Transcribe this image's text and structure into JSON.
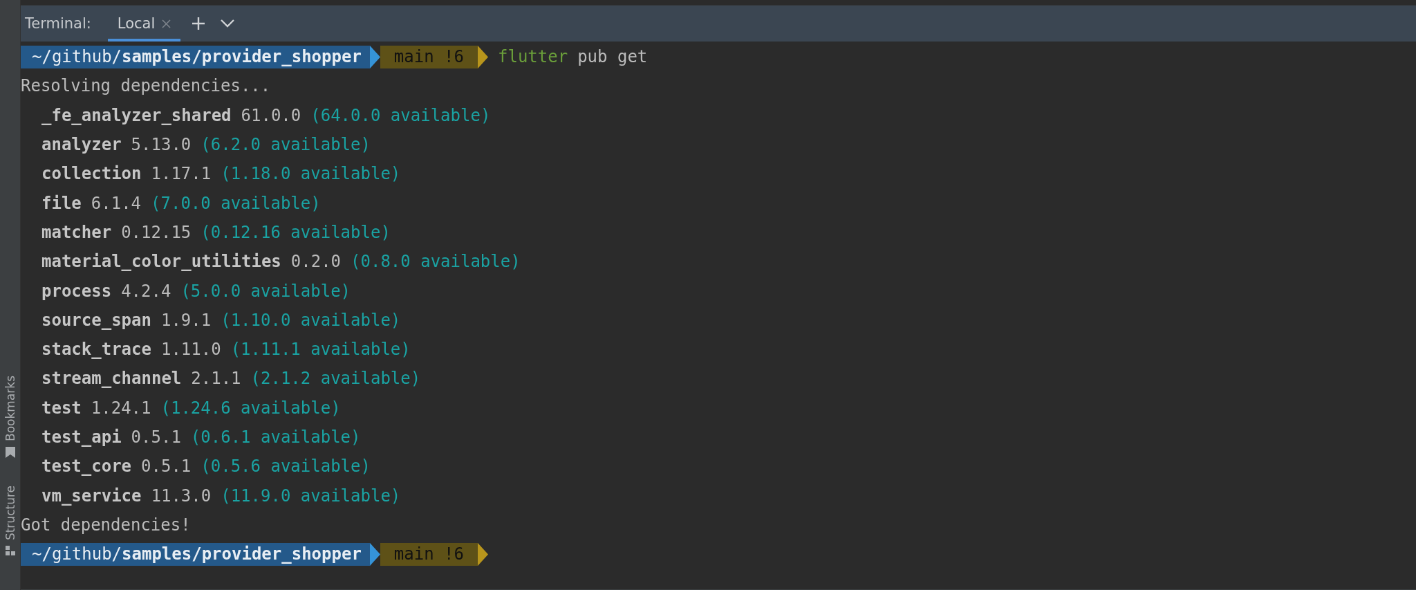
{
  "side_tabs": [
    {
      "label": "Bookmarks"
    },
    {
      "label": "Structure"
    }
  ],
  "terminal": {
    "label": "Terminal:",
    "tabs": [
      {
        "label": "Local",
        "selected": true
      }
    ]
  },
  "lines": [
    {
      "kind": "prompt",
      "path": "~/github/**samples/provider_shopper**",
      "branch": "main !6",
      "program": "flutter",
      "args": "pub get"
    },
    {
      "kind": "plain",
      "text": "Resolving dependencies..."
    },
    {
      "kind": "package",
      "name": "_fe_analyzer_shared",
      "version": "61.0.0",
      "available": "(64.0.0 available)"
    },
    {
      "kind": "package",
      "name": "analyzer",
      "version": "5.13.0",
      "available": "(6.2.0 available)"
    },
    {
      "kind": "package",
      "name": "collection",
      "version": "1.17.1",
      "available": "(1.18.0 available)"
    },
    {
      "kind": "package",
      "name": "file",
      "version": "6.1.4",
      "available": "(7.0.0 available)"
    },
    {
      "kind": "package",
      "name": "matcher",
      "version": "0.12.15",
      "available": "(0.12.16 available)"
    },
    {
      "kind": "package",
      "name": "material_color_utilities",
      "version": "0.2.0",
      "available": "(0.8.0 available)"
    },
    {
      "kind": "package",
      "name": "process",
      "version": "4.2.4",
      "available": "(5.0.0 available)"
    },
    {
      "kind": "package",
      "name": "source_span",
      "version": "1.9.1",
      "available": "(1.10.0 available)"
    },
    {
      "kind": "package",
      "name": "stack_trace",
      "version": "1.11.0",
      "available": "(1.11.1 available)"
    },
    {
      "kind": "package",
      "name": "stream_channel",
      "version": "2.1.1",
      "available": "(2.1.2 available)"
    },
    {
      "kind": "package",
      "name": "test",
      "version": "1.24.1",
      "available": "(1.24.6 available)"
    },
    {
      "kind": "package",
      "name": "test_api",
      "version": "0.5.1",
      "available": "(0.6.1 available)"
    },
    {
      "kind": "package",
      "name": "test_core",
      "version": "0.5.1",
      "available": "(0.5.6 available)"
    },
    {
      "kind": "package",
      "name": "vm_service",
      "version": "11.3.0",
      "available": "(11.9.0 available)"
    },
    {
      "kind": "plain",
      "text": "Got dependencies!"
    },
    {
      "kind": "prompt",
      "path": "~/github/**samples/provider_shopper**",
      "branch": "main !6"
    }
  ]
}
